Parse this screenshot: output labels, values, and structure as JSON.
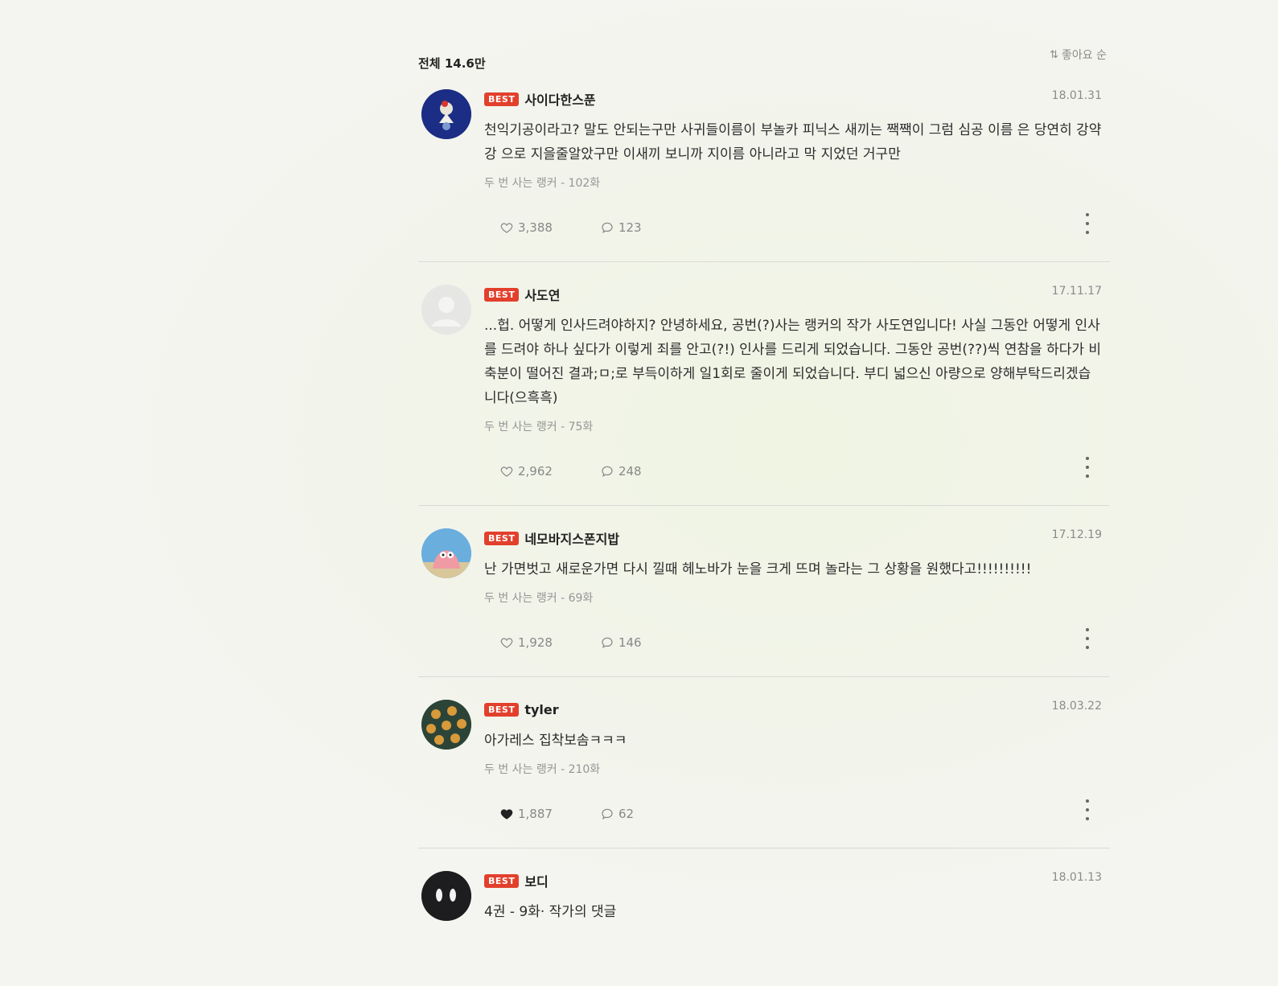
{
  "header": {
    "total": "전체 14.6만",
    "sort_label": "좋아요 순"
  },
  "badge": "BEST",
  "comments": [
    {
      "nickname": "사이다한스푼",
      "date": "18.01.31",
      "text": "천익기공이라고? 말도 안되는구만 사귀들이름이 부놀카 피닉스 새끼는 짹짹이 그럼 심공 이름 은 당연히 강약강 으로 지을줄알았구만 이새끼 보니까 지이름 아니라고 막 지었던 거구만",
      "source": "두 번 사는 랭커 - 102화",
      "likes": "3,388",
      "replies": "123",
      "liked": false
    },
    {
      "nickname": "사도연",
      "date": "17.11.17",
      "text": "...헙. 어떻게 인사드려야하지? 안녕하세요, 공번(?)사는 랭커의 작가 사도연입니다! 사실 그동안 어떻게 인사를 드려야 하나 싶다가 이렇게 죄를 안고(?!) 인사를 드리게 되었습니다. 그동안 공번(??)씩 연참을 하다가 비축분이 떨어진 결과;ㅁ;로 부득이하게 일1회로 줄이게 되었습니다. 부디 넓으신 아량으로 양해부탁드리겠습니다(으흑흑)",
      "source": "두 번 사는 랭커 - 75화",
      "likes": "2,962",
      "replies": "248",
      "liked": false
    },
    {
      "nickname": "네모바지스폰지밥",
      "date": "17.12.19",
      "text": "난 가면벗고 새로운가면 다시 낄때 헤노바가 눈을 크게 뜨며 놀라는 그 상황을 원했다고!!!!!!!!!!",
      "source": "두 번 사는 랭커 - 69화",
      "likes": "1,928",
      "replies": "146",
      "liked": false
    },
    {
      "nickname": "tyler",
      "date": "18.03.22",
      "text": "아가레스 집착보솜ㅋㅋㅋ",
      "source": "두 번 사는 랭커 - 210화",
      "likes": "1,887",
      "replies": "62",
      "liked": true
    },
    {
      "nickname": "보디",
      "date": "18.01.13",
      "text": "4권 - 9화· 작가의 댓글",
      "source": "",
      "likes": "",
      "replies": "",
      "liked": false
    }
  ],
  "colors": {
    "best_badge": "#e2402c",
    "background": "#f4f4f1"
  },
  "icons": [
    "sort-icon",
    "heart-icon",
    "heart-filled-icon",
    "reply-bubble-icon",
    "more-vertical-icon",
    "avatar-icon"
  ]
}
